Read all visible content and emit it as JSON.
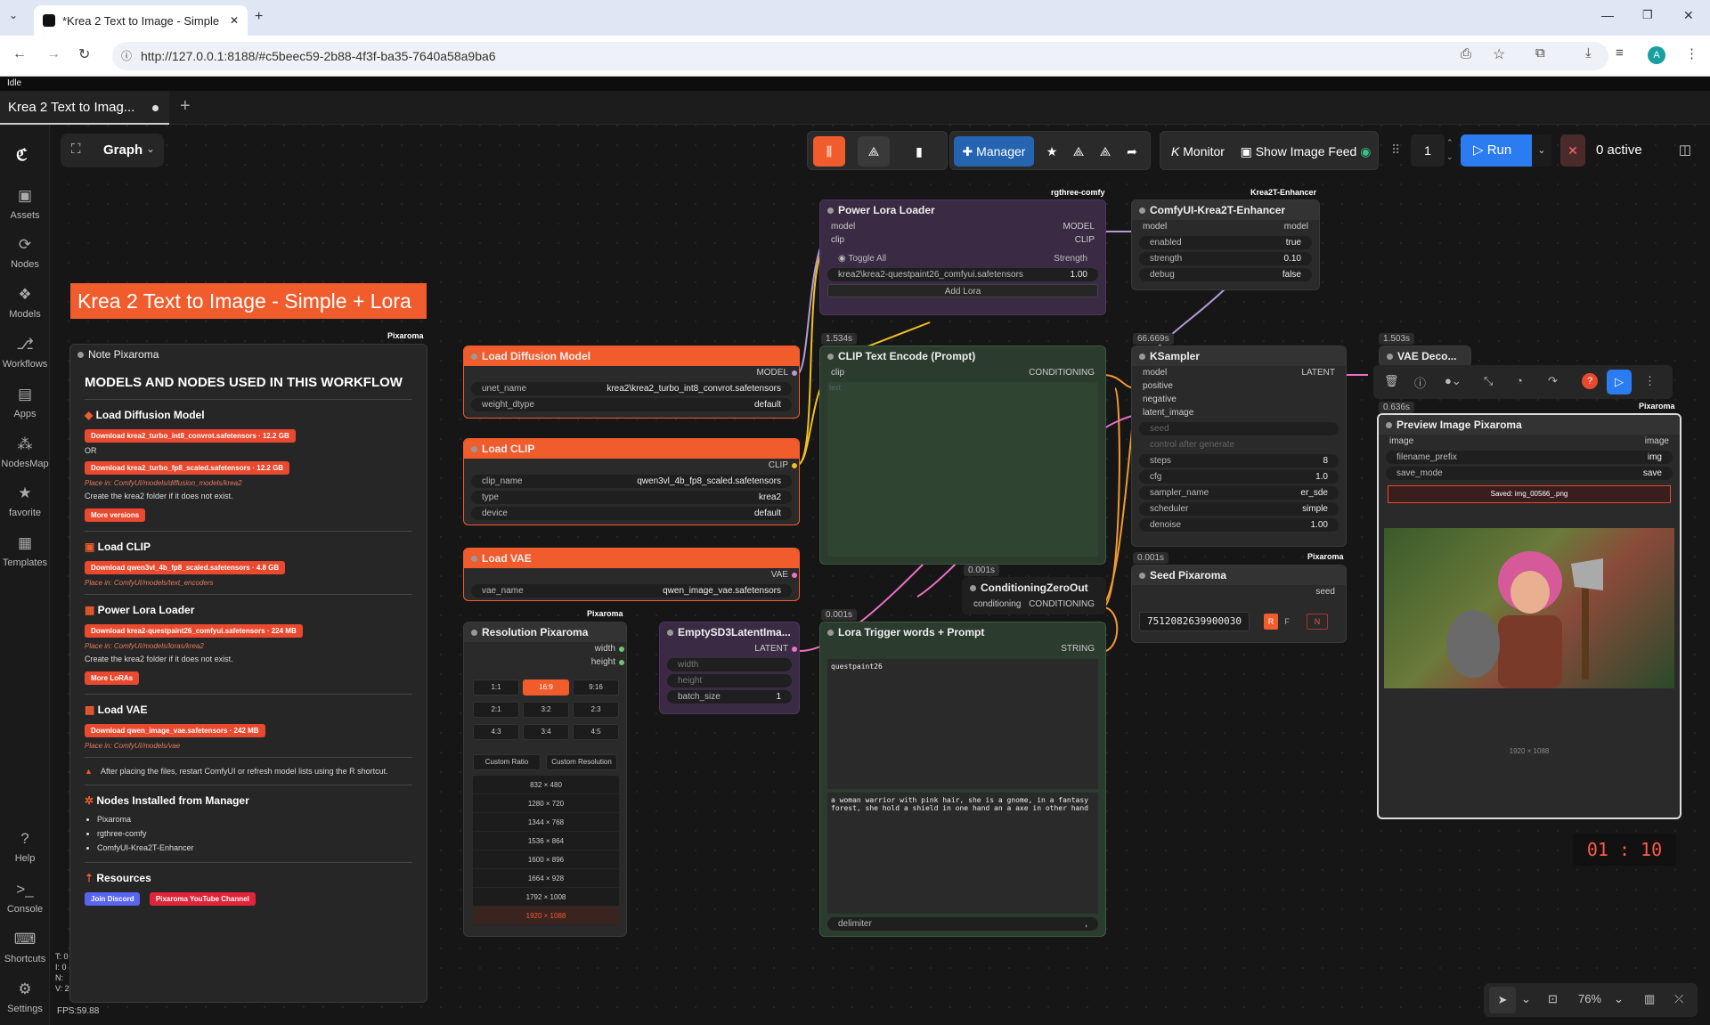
{
  "browser": {
    "tab_title": "*Krea 2 Text to Image - Simple",
    "url": "http://127.0.0.1:8188/#c5beec59-2b88-4f3f-ba35-7640a58a9ba6"
  },
  "app": {
    "status": "Idle",
    "workflow_tab": "Krea 2 Text to Imag...",
    "graph_label": "Graph",
    "fps": "FPS:59.88"
  },
  "sidebar": [
    {
      "label": "Assets",
      "icon": "image-icon"
    },
    {
      "label": "Nodes",
      "icon": "nodes-icon"
    },
    {
      "label": "Models",
      "icon": "models-icon"
    },
    {
      "label": "Workflows",
      "icon": "workflow-icon"
    },
    {
      "label": "Apps",
      "icon": "apps-icon"
    },
    {
      "label": "NodesMap",
      "icon": "nodesmap-icon"
    },
    {
      "label": "favorite",
      "icon": "star-icon"
    },
    {
      "label": "Templates",
      "icon": "templates-icon"
    },
    {
      "label": "Help",
      "icon": "help-icon"
    },
    {
      "label": "Console",
      "icon": "console-icon"
    },
    {
      "label": "Shortcuts",
      "icon": "keyboard-icon"
    },
    {
      "label": "Settings",
      "icon": "gear-icon"
    }
  ],
  "toolbar": {
    "manager": "Manager",
    "monitor": "Monitor",
    "show_feed": "Show Image Feed",
    "queue_count": "1",
    "run": "Run",
    "active": "0 active"
  },
  "title_banner": "Krea 2 Text to Image - Simple + Lora",
  "note": {
    "title": "Note Pixaroma",
    "tag": "Pixaroma",
    "heading": "MODELS AND NODES USED IN THIS WORKFLOW",
    "s1": "Load Diffusion Model",
    "s1b1": "Download krea2_turbo_int8_convrot.safetensors · 12.2 GB",
    "or": "OR",
    "s1b2": "Download krea2_turbo_fp8_scaled.safetensors · 12.2 GB",
    "s1p": "Place in: ComfyUI/models/diffusion_models/krea2",
    "s1t": "Create the  krea2  folder if it does not exist.",
    "more_versions": "More versions",
    "s2": "Load CLIP",
    "s2b": "Download qwen3vl_4b_fp8_scaled.safetensors · 4.8 GB",
    "s2p": "Place in: ComfyUI/models/text_encoders",
    "s3": "Power Lora Loader",
    "s3b": "Download krea2-questpaint26_comfyui.safetensors · 224 MB",
    "s3p": "Place in: ComfyUI/models/loras/krea2",
    "s3t": "Create the  krea2  folder if it does not exist.",
    "more_loras": "More LoRAs",
    "s4": "Load VAE",
    "s4b": "Download qwen_image_vae.safetensors · 242 MB",
    "s4p": "Place in: ComfyUI/models/vae",
    "warn": "After placing the files, restart ComfyUI or refresh model lists using the R shortcut.",
    "s5": "Nodes Installed from Manager",
    "n1": "Pixaroma",
    "n2": "rgthree-comfy",
    "n3": "ComfyUI-Krea2T-Enhancer",
    "s6": "Resources",
    "discord": "Join Discord",
    "yt": "Pixaroma YouTube Channel"
  },
  "load_diffusion": {
    "title": "Load Diffusion Model",
    "out": "MODEL",
    "unet_label": "unet_name",
    "unet": "krea2\\krea2_turbo_int8_convrot.safetensors",
    "wd_label": "weight_dtype",
    "wd": "default"
  },
  "load_clip": {
    "title": "Load CLIP",
    "out": "CLIP",
    "name_label": "clip_name",
    "name": "qwen3vl_4b_fp8_scaled.safetensors",
    "type_label": "type",
    "type": "krea2",
    "dev_label": "device",
    "dev": "default"
  },
  "load_vae": {
    "title": "Load VAE",
    "out": "VAE",
    "name_label": "vae_name",
    "name": "qwen_image_vae.safetensors"
  },
  "resolution": {
    "title": "Resolution Pixaroma",
    "tag": "Pixaroma",
    "o1": "width",
    "o2": "height",
    "ratios": [
      "1:1",
      "16:9",
      "9:16",
      "2:1",
      "3:2",
      "2:3",
      "4:3",
      "3:4",
      "4:5"
    ],
    "custom_ratio": "Custom Ratio",
    "custom_res": "Custom Resolution",
    "sizes": [
      "832 × 480",
      "1280 × 720",
      "1344 × 768",
      "1536 × 864",
      "1600 × 896",
      "1664 × 928",
      "1792 × 1008",
      "1920 × 1088"
    ]
  },
  "empty_latent": {
    "title": "EmptySD3LatentIma...",
    "out": "LATENT",
    "w": "width",
    "h": "height",
    "bs_label": "batch_size",
    "bs": "1"
  },
  "power_lora": {
    "title": "Power Lora Loader",
    "tag": "rgthree-comfy",
    "in1": "model",
    "in2": "clip",
    "o1": "MODEL",
    "o2": "CLIP",
    "toggle": "Toggle All",
    "strength": "Strength",
    "lora": "krea2\\krea2-questpaint26_comfyui.safetensors",
    "lora_val": "1.00",
    "add": "Add Lora"
  },
  "clip_encode": {
    "title": "CLIP Text Encode (Prompt)",
    "time": "1.534s",
    "in": "clip",
    "out": "CONDITIONING",
    "text": "text"
  },
  "enhancer": {
    "title": "ComfyUI-Krea2T-Enhancer",
    "tag": "Krea2T-Enhancer",
    "in": "model",
    "out": "model",
    "enabled_label": "enabled",
    "enabled": "true",
    "strength_label": "strength",
    "strength": "0.10",
    "debug_label": "debug",
    "debug": "false"
  },
  "ksampler": {
    "title": "KSampler",
    "time": "66.669s",
    "ins": [
      "model",
      "positive",
      "negative",
      "latent_image"
    ],
    "out": "LATENT",
    "seed_label": "seed",
    "cag": "control after generate",
    "steps_label": "steps",
    "steps": "8",
    "cfg_label": "cfg",
    "cfg": "1.0",
    "sampler_label": "sampler_name",
    "sampler": "er_sde",
    "sched_label": "scheduler",
    "sched": "simple",
    "denoise_label": "denoise",
    "denoise": "1.00"
  },
  "vae_decode": {
    "title": "VAE Deco...",
    "time": "1.503s"
  },
  "zero_out": {
    "title": "ConditioningZeroOut",
    "time": "0.001s",
    "in": "conditioning",
    "out": "CONDITIONING"
  },
  "seed": {
    "title": "Seed Pixaroma",
    "time": "0.001s",
    "tag": "Pixaroma",
    "out": "seed",
    "value": "7512082639900030",
    "r": "R",
    "f": "F",
    "n": "N"
  },
  "lora_prompt": {
    "title": "Lora Trigger words + Prompt",
    "time": "0.001s",
    "out": "STRING",
    "trigger": "questpaint26",
    "prompt": "a woman warrior with pink hair, she is a gnome, in a fantasy forest, she hold a shield in one hand an a axe in other hand",
    "delimiter": "delimiter",
    "delim_val": ","
  },
  "preview": {
    "title": "Preview Image Pixaroma",
    "time": "0.636s",
    "tag": "Pixaroma",
    "in": "image",
    "out": "image",
    "prefix_label": "filename_prefix",
    "prefix": "img",
    "save_label": "save_mode",
    "save": "save",
    "saved": "Saved: img_00566_.png",
    "dims": "1920 × 1088"
  },
  "timer": "01 : 10",
  "zoom": "76%",
  "colors": {
    "accent": "#f05c2c",
    "run": "#2a7cf0",
    "manager": "#2464b0"
  }
}
